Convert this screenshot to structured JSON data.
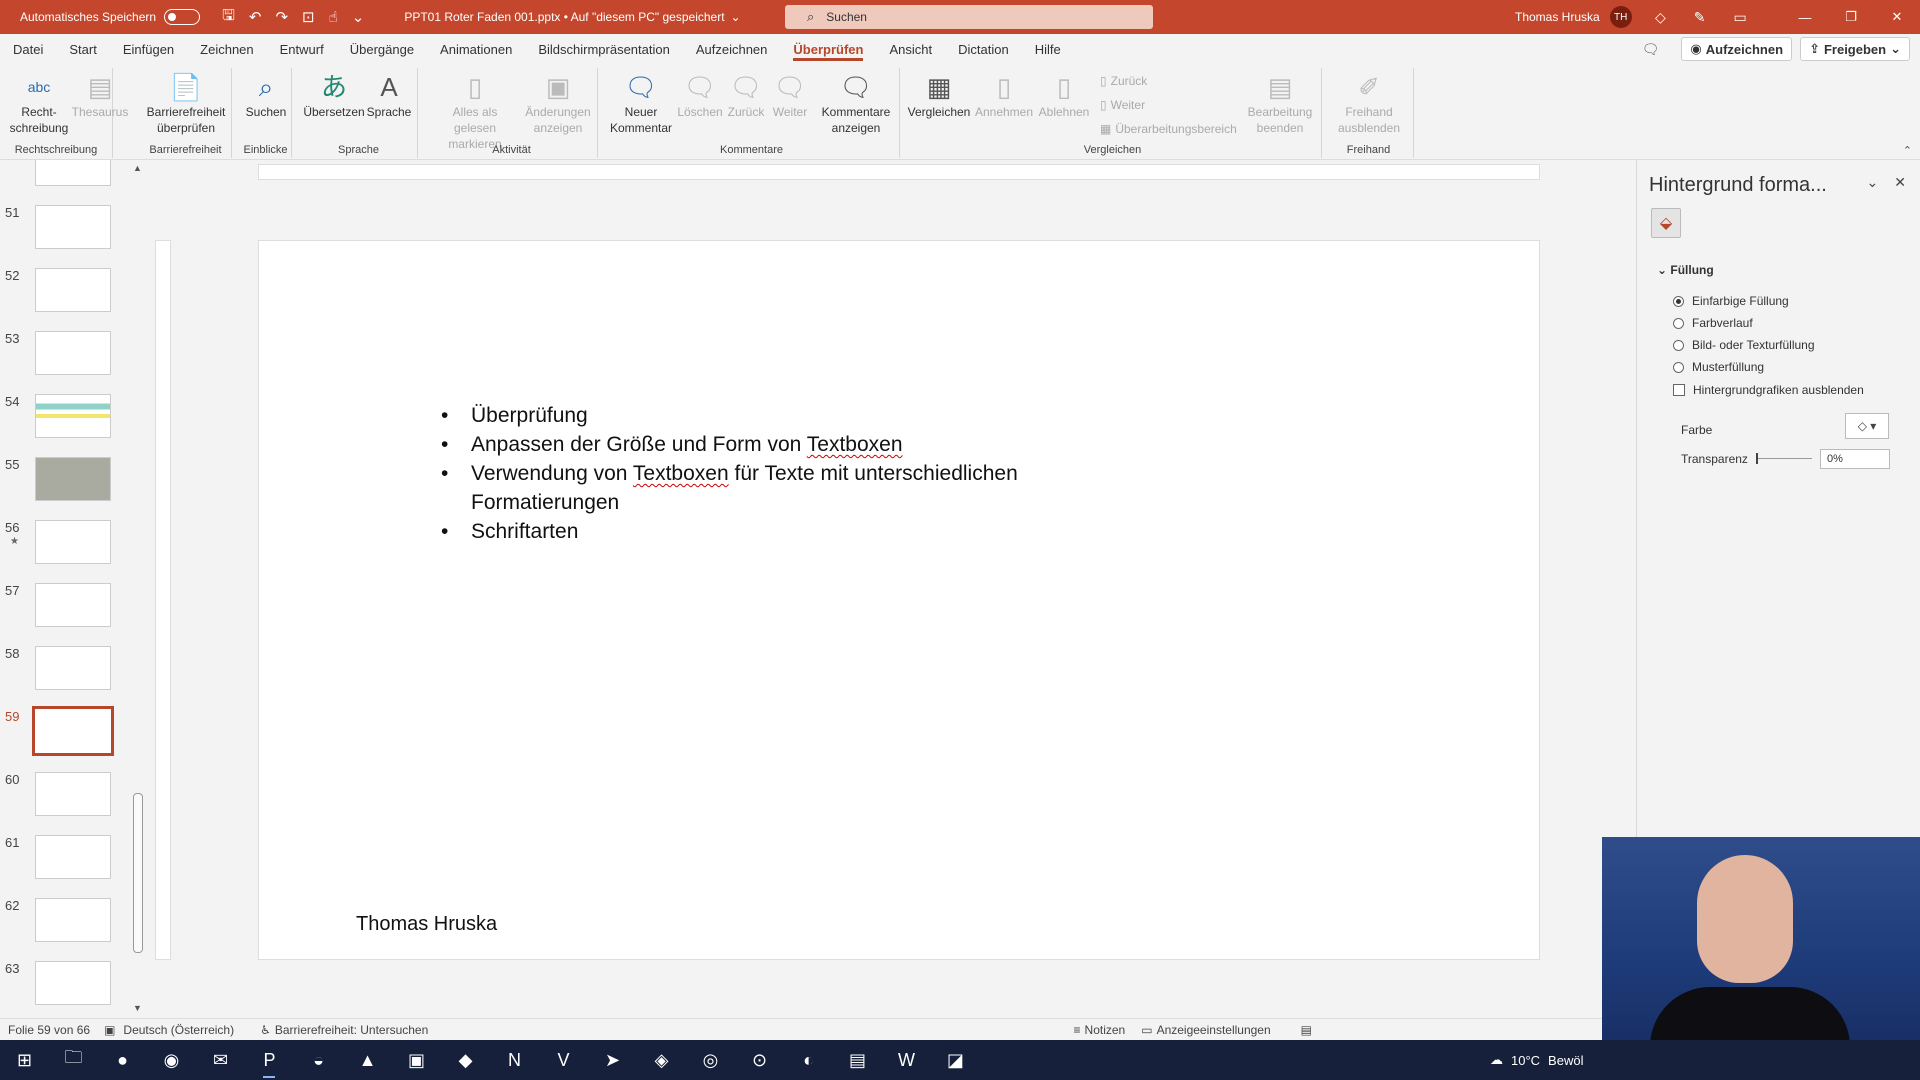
{
  "titlebar": {
    "autosave_label": "Automatisches Speichern",
    "document_title": "PPT01 Roter Faden 001.pptx • Auf \"diesem PC\" gespeichert",
    "search_placeholder": "Suchen",
    "user_name": "Thomas Hruska",
    "user_initials": "TH"
  },
  "menu": {
    "tabs": [
      "Datei",
      "Start",
      "Einfügen",
      "Zeichnen",
      "Entwurf",
      "Übergänge",
      "Animationen",
      "Bildschirmpräsentation",
      "Aufzeichnen",
      "Überprüfen",
      "Ansicht",
      "Dictation",
      "Hilfe"
    ],
    "active_tab": "Überprüfen",
    "record_button": "Aufzeichnen",
    "share_button": "Freigeben"
  },
  "ribbon": {
    "groups": {
      "rechtschreibung": "Rechtschreibung",
      "barrierefreiheit": "Barrierefreiheit",
      "einblicke": "Einblicke",
      "sprache": "Sprache",
      "aktivitaet": "Aktivität",
      "kommentare": "Kommentare",
      "vergleichen": "Vergleichen",
      "freihand": "Freihand"
    },
    "buttons": {
      "spelling_icon_text": "abc",
      "spelling_line1": "Recht-",
      "spelling_line2": "schreibung",
      "thesaurus": "Thesaurus",
      "accessibility_line1": "Barrierefreiheit",
      "accessibility_line2": "überprüfen",
      "search": "Suchen",
      "translate": "Übersetzen",
      "language": "Sprache",
      "mark_read_line1": "Alles als gelesen",
      "mark_read_line2": "markieren",
      "changes_line1": "Änderungen",
      "changes_line2": "anzeigen",
      "new_comment_line1": "Neuer",
      "new_comment_line2": "Kommentar",
      "delete": "Löschen",
      "back": "Zurück",
      "next": "Weiter",
      "show_comments_line1": "Kommentare",
      "show_comments_line2": "anzeigen",
      "compare": "Vergleichen",
      "accept": "Annehmen",
      "reject": "Ablehnen",
      "prev_small": "Zurück",
      "next_small": "Weiter",
      "review_pane": "Überarbeitungsbereich",
      "end_review_line1": "Bearbeitung",
      "end_review_line2": "beenden",
      "hide_ink_line1": "Freihand",
      "hide_ink_line2": "ausblenden"
    }
  },
  "thumbnails": {
    "numbers": [
      "51",
      "52",
      "53",
      "54",
      "55",
      "56",
      "57",
      "58",
      "59",
      "60",
      "61",
      "62",
      "63"
    ],
    "selected": "59",
    "starred": "56"
  },
  "slide": {
    "bullets": [
      {
        "pre": "Überprüfung",
        "mark": "",
        "post": ""
      },
      {
        "pre": "Anpassen der Größe und Form von ",
        "mark": "Textboxen",
        "post": ""
      },
      {
        "pre": "Verwendung von ",
        "mark": "Textboxen",
        "post": " für Texte mit unterschiedlichen Formatierungen"
      },
      {
        "pre": "Schriftarten",
        "mark": "",
        "post": ""
      }
    ],
    "author": "Thomas Hruska"
  },
  "pane": {
    "title": "Hintergrund forma...",
    "section": "Füllung",
    "options": [
      "Einfarbige Füllung",
      "Farbverlauf",
      "Bild- oder Texturfüllung",
      "Musterfüllung"
    ],
    "selected_option": "Einfarbige Füllung",
    "hide_graphics": "Hintergrundgrafiken ausblenden",
    "color_label": "Farbe",
    "transparency_label": "Transparenz",
    "transparency_value": "0%"
  },
  "statusbar": {
    "slide_info": "Folie 59 von 66",
    "language": "Deutsch (Österreich)",
    "accessibility": "Barrierefreiheit: Untersuchen",
    "notes": "Notizen",
    "display_settings": "Anzeigeeinstellungen"
  },
  "taskbar": {
    "temperature": "10°C",
    "weather": "Bewöl"
  }
}
